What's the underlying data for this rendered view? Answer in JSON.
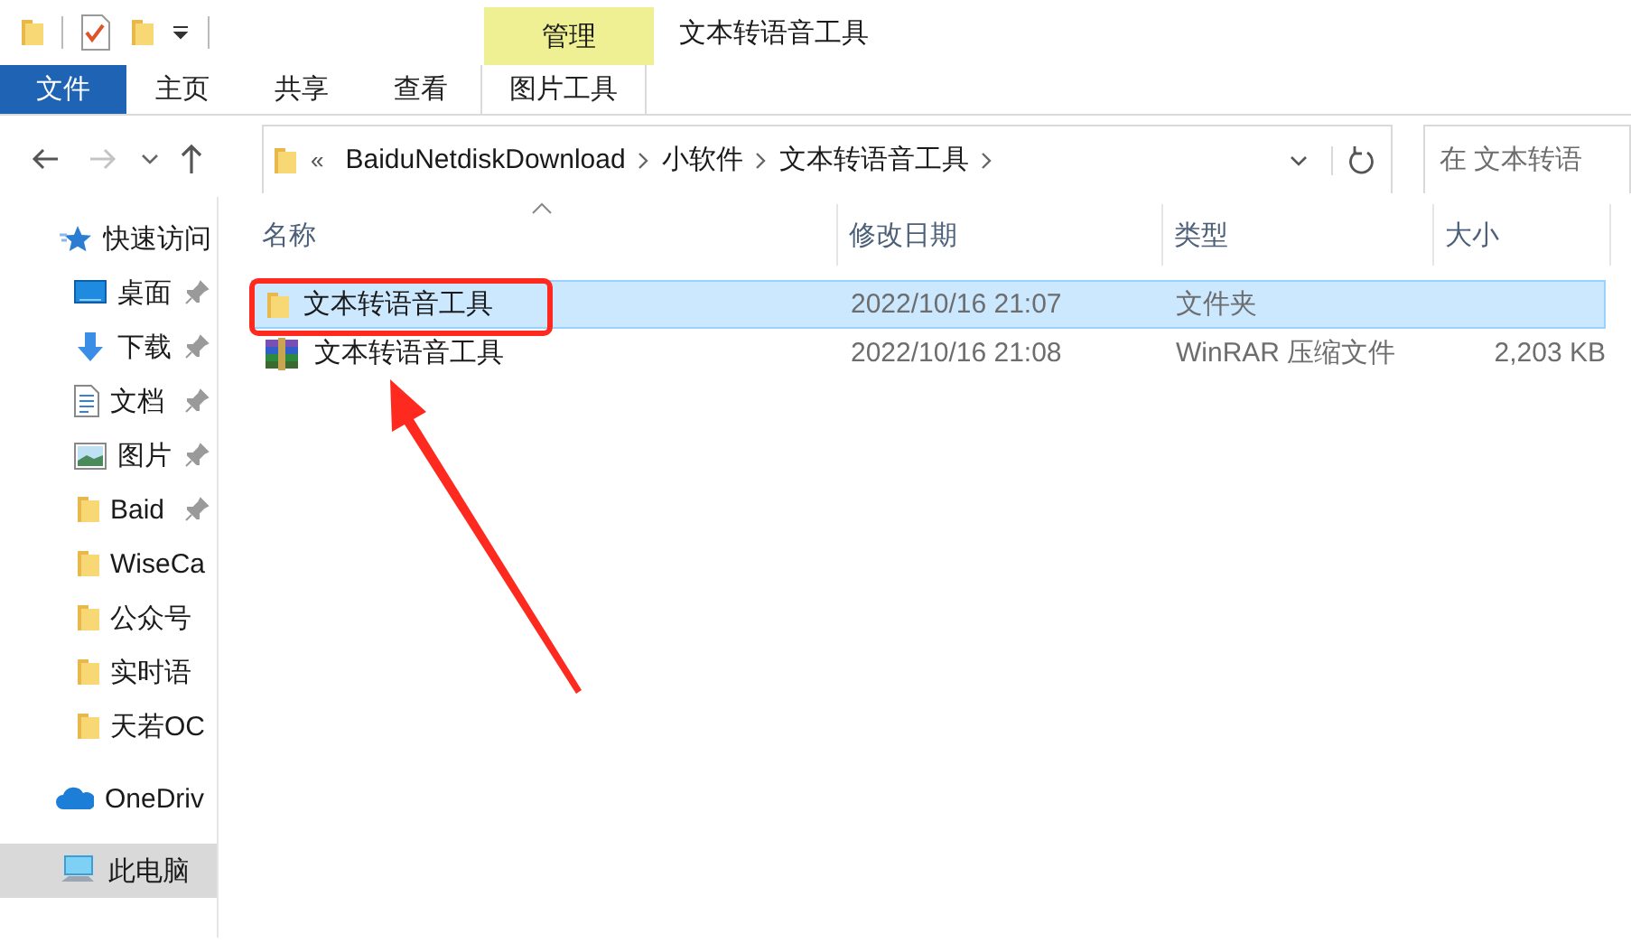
{
  "window": {
    "title": "文本转语音工具"
  },
  "ribbon": {
    "contextual_group": "管理",
    "tabs": [
      {
        "label": "文件",
        "kind": "file"
      },
      {
        "label": "主页",
        "kind": "normal"
      },
      {
        "label": "共享",
        "kind": "normal"
      },
      {
        "label": "查看",
        "kind": "normal"
      },
      {
        "label": "图片工具",
        "kind": "contextual"
      }
    ]
  },
  "navigation": {
    "back": {
      "disabled": false
    },
    "forward": {
      "disabled": true
    },
    "overflow_mark": "«",
    "breadcrumbs": [
      "BaiduNetdiskDownload",
      "小软件",
      "文本转语音工具"
    ],
    "search": {
      "placeholder": "在 文本转语"
    }
  },
  "sidebar": {
    "items": [
      {
        "label": "快速访问",
        "kind": "star",
        "pinned": false,
        "selected": false
      },
      {
        "label": "桌面",
        "kind": "desktop",
        "pinned": true,
        "selected": false
      },
      {
        "label": "下载",
        "kind": "download",
        "pinned": true,
        "selected": false
      },
      {
        "label": "文档",
        "kind": "document",
        "pinned": true,
        "selected": false
      },
      {
        "label": "图片",
        "kind": "pictures",
        "pinned": true,
        "selected": false
      },
      {
        "label": "Baid",
        "kind": "folder",
        "pinned": true,
        "selected": false
      },
      {
        "label": "WiseCa",
        "kind": "folder",
        "pinned": false,
        "selected": false
      },
      {
        "label": "公众号",
        "kind": "folder",
        "pinned": false,
        "selected": false
      },
      {
        "label": "实时语",
        "kind": "folder",
        "pinned": false,
        "selected": false
      },
      {
        "label": "天若OC",
        "kind": "folder",
        "pinned": false,
        "selected": false
      },
      {
        "label": "OneDriv",
        "kind": "onedrive",
        "pinned": false,
        "selected": false
      },
      {
        "label": "此电脑",
        "kind": "pc",
        "pinned": false,
        "selected": true
      }
    ]
  },
  "table": {
    "columns": [
      "名称",
      "修改日期",
      "类型",
      "大小"
    ],
    "rows": [
      {
        "kind": "folder",
        "name": "文本转语音工具",
        "modified": "2022/10/16 21:07",
        "type": "文件夹",
        "size": "",
        "selected": true
      },
      {
        "kind": "archive",
        "name": "文本转语音工具",
        "modified": "2022/10/16 21:08",
        "type": "WinRAR 压缩文件",
        "size": "2,203 KB",
        "selected": false
      }
    ]
  },
  "annotations": {
    "highlight_box": {
      "color": "#ff2a1f"
    },
    "arrow": {
      "color": "#ff2a1f"
    }
  }
}
